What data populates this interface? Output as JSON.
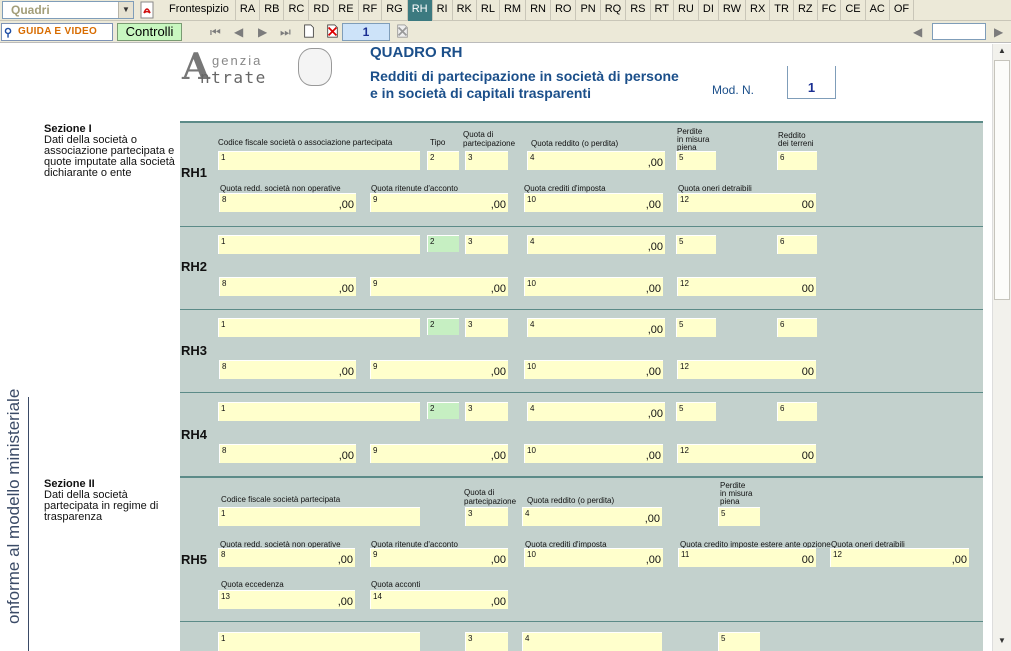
{
  "toolbar": {
    "select_value": "Quadri",
    "tabs": [
      "Frontespizio",
      "RA",
      "RB",
      "RC",
      "RD",
      "RE",
      "RF",
      "RG",
      "RH",
      "RI",
      "RK",
      "RL",
      "RM",
      "RN",
      "RO",
      "PN",
      "RQ",
      "RS",
      "RT",
      "RU",
      "DI",
      "RW",
      "RX",
      "TR",
      "RZ",
      "FC",
      "CE",
      "AC",
      "OF"
    ],
    "active_tab": "RH",
    "guida_label": "GUIDA E VIDEO",
    "controlli_label": "Controlli",
    "page_number": "1"
  },
  "header": {
    "logo_top": "genzia",
    "logo_bottom": "ntrate",
    "logo_letter": "A",
    "title": "QUADRO RH",
    "subtitle_1": "Redditi di partecipazione in società di persone",
    "subtitle_2": "e in società di capitali trasparenti",
    "mod_label": "Mod. N.",
    "mod_value": "1"
  },
  "sidebar_vertical_text": "onforme al modello ministeriale",
  "section1": {
    "title": "Sezione I",
    "description": "Dati della società o associazione partecipata e quote imputate alla società dichiarante o ente",
    "labels": {
      "codice_fiscale": "Codice fiscale società o associazione partecipata",
      "tipo": "Tipo",
      "quota_partecipazione_1": "Quota di",
      "quota_partecipazione_2": "partecipazione",
      "quota_reddito": "Quota reddito (o perdita)",
      "perdite_1": "Perdite",
      "perdite_2": "in misura",
      "perdite_3": "piena",
      "reddito_terreni_1": "Reddito",
      "reddito_terreni_2": "dei terreni",
      "non_operative": "Quota redd. società non operative",
      "ritenute": "Quota ritenute d'acconto",
      "crediti": "Quota crediti d'imposta",
      "oneri": "Quota oneri detraibili"
    },
    "rows": [
      "RH1",
      "RH2",
      "RH3",
      "RH4"
    ]
  },
  "section2": {
    "title": "Sezione II",
    "description": "Dati della società partecipata in regime di trasparenza",
    "labels": {
      "codice_fiscale": "Codice fiscale società partecipata",
      "quota_partecipazione_1": "Quota di",
      "quota_partecipazione_2": "partecipazione",
      "quota_reddito": "Quota reddito (o perdita)",
      "perdite_1": "Perdite",
      "perdite_2": "in misura",
      "perdite_3": "piena",
      "non_operative": "Quota redd. società non operative",
      "ritenute": "Quota ritenute d'acconto",
      "crediti": "Quota crediti d'imposta",
      "credito_estero": "Quota credito imposte estere ante opzione",
      "oneri": "Quota oneri detraibili",
      "eccedenza": "Quota eccedenza",
      "acconti": "Quota acconti"
    },
    "rows": [
      "RH5"
    ]
  },
  "values": {
    "decimals": ",00",
    "decimals_short": "00"
  },
  "fieldnums": [
    "1",
    "2",
    "3",
    "4",
    "5",
    "6",
    "8",
    "9",
    "10",
    "11",
    "12",
    "13",
    "14"
  ]
}
